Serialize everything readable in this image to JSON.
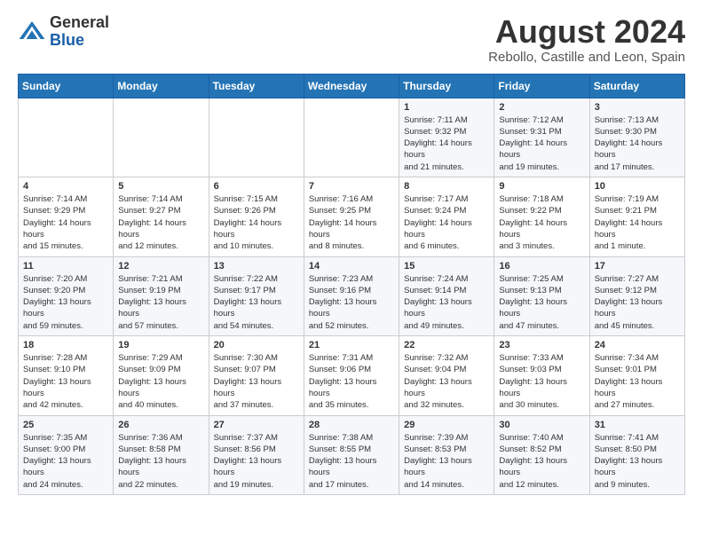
{
  "header": {
    "logo_general": "General",
    "logo_blue": "Blue",
    "title": "August 2024",
    "subtitle": "Rebollo, Castille and Leon, Spain"
  },
  "weekdays": [
    "Sunday",
    "Monday",
    "Tuesday",
    "Wednesday",
    "Thursday",
    "Friday",
    "Saturday"
  ],
  "weeks": [
    [
      {
        "day": "",
        "info": ""
      },
      {
        "day": "",
        "info": ""
      },
      {
        "day": "",
        "info": ""
      },
      {
        "day": "",
        "info": ""
      },
      {
        "day": "1",
        "info": "Sunrise: 7:11 AM\nSunset: 9:32 PM\nDaylight: 14 hours and 21 minutes."
      },
      {
        "day": "2",
        "info": "Sunrise: 7:12 AM\nSunset: 9:31 PM\nDaylight: 14 hours and 19 minutes."
      },
      {
        "day": "3",
        "info": "Sunrise: 7:13 AM\nSunset: 9:30 PM\nDaylight: 14 hours and 17 minutes."
      }
    ],
    [
      {
        "day": "4",
        "info": "Sunrise: 7:14 AM\nSunset: 9:29 PM\nDaylight: 14 hours and 15 minutes."
      },
      {
        "day": "5",
        "info": "Sunrise: 7:14 AM\nSunset: 9:27 PM\nDaylight: 14 hours and 12 minutes."
      },
      {
        "day": "6",
        "info": "Sunrise: 7:15 AM\nSunset: 9:26 PM\nDaylight: 14 hours and 10 minutes."
      },
      {
        "day": "7",
        "info": "Sunrise: 7:16 AM\nSunset: 9:25 PM\nDaylight: 14 hours and 8 minutes."
      },
      {
        "day": "8",
        "info": "Sunrise: 7:17 AM\nSunset: 9:24 PM\nDaylight: 14 hours and 6 minutes."
      },
      {
        "day": "9",
        "info": "Sunrise: 7:18 AM\nSunset: 9:22 PM\nDaylight: 14 hours and 3 minutes."
      },
      {
        "day": "10",
        "info": "Sunrise: 7:19 AM\nSunset: 9:21 PM\nDaylight: 14 hours and 1 minute."
      }
    ],
    [
      {
        "day": "11",
        "info": "Sunrise: 7:20 AM\nSunset: 9:20 PM\nDaylight: 13 hours and 59 minutes."
      },
      {
        "day": "12",
        "info": "Sunrise: 7:21 AM\nSunset: 9:19 PM\nDaylight: 13 hours and 57 minutes."
      },
      {
        "day": "13",
        "info": "Sunrise: 7:22 AM\nSunset: 9:17 PM\nDaylight: 13 hours and 54 minutes."
      },
      {
        "day": "14",
        "info": "Sunrise: 7:23 AM\nSunset: 9:16 PM\nDaylight: 13 hours and 52 minutes."
      },
      {
        "day": "15",
        "info": "Sunrise: 7:24 AM\nSunset: 9:14 PM\nDaylight: 13 hours and 49 minutes."
      },
      {
        "day": "16",
        "info": "Sunrise: 7:25 AM\nSunset: 9:13 PM\nDaylight: 13 hours and 47 minutes."
      },
      {
        "day": "17",
        "info": "Sunrise: 7:27 AM\nSunset: 9:12 PM\nDaylight: 13 hours and 45 minutes."
      }
    ],
    [
      {
        "day": "18",
        "info": "Sunrise: 7:28 AM\nSunset: 9:10 PM\nDaylight: 13 hours and 42 minutes."
      },
      {
        "day": "19",
        "info": "Sunrise: 7:29 AM\nSunset: 9:09 PM\nDaylight: 13 hours and 40 minutes."
      },
      {
        "day": "20",
        "info": "Sunrise: 7:30 AM\nSunset: 9:07 PM\nDaylight: 13 hours and 37 minutes."
      },
      {
        "day": "21",
        "info": "Sunrise: 7:31 AM\nSunset: 9:06 PM\nDaylight: 13 hours and 35 minutes."
      },
      {
        "day": "22",
        "info": "Sunrise: 7:32 AM\nSunset: 9:04 PM\nDaylight: 13 hours and 32 minutes."
      },
      {
        "day": "23",
        "info": "Sunrise: 7:33 AM\nSunset: 9:03 PM\nDaylight: 13 hours and 30 minutes."
      },
      {
        "day": "24",
        "info": "Sunrise: 7:34 AM\nSunset: 9:01 PM\nDaylight: 13 hours and 27 minutes."
      }
    ],
    [
      {
        "day": "25",
        "info": "Sunrise: 7:35 AM\nSunset: 9:00 PM\nDaylight: 13 hours and 24 minutes."
      },
      {
        "day": "26",
        "info": "Sunrise: 7:36 AM\nSunset: 8:58 PM\nDaylight: 13 hours and 22 minutes."
      },
      {
        "day": "27",
        "info": "Sunrise: 7:37 AM\nSunset: 8:56 PM\nDaylight: 13 hours and 19 minutes."
      },
      {
        "day": "28",
        "info": "Sunrise: 7:38 AM\nSunset: 8:55 PM\nDaylight: 13 hours and 17 minutes."
      },
      {
        "day": "29",
        "info": "Sunrise: 7:39 AM\nSunset: 8:53 PM\nDaylight: 13 hours and 14 minutes."
      },
      {
        "day": "30",
        "info": "Sunrise: 7:40 AM\nSunset: 8:52 PM\nDaylight: 13 hours and 12 minutes."
      },
      {
        "day": "31",
        "info": "Sunrise: 7:41 AM\nSunset: 8:50 PM\nDaylight: 13 hours and 9 minutes."
      }
    ]
  ]
}
